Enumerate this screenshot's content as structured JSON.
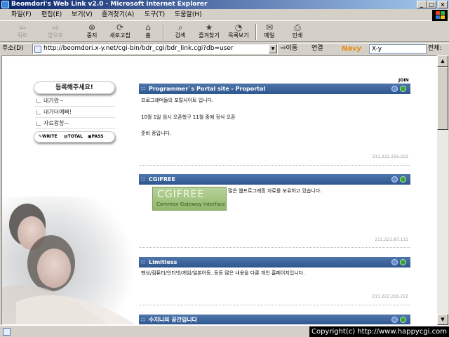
{
  "window": {
    "title": "Beomdori's Web Link v2.0 - Microsoft Internet Explorer",
    "controls": {
      "minimize": "_",
      "maximize": "□",
      "close": "×"
    }
  },
  "menu": [
    "파일(F)",
    "편집(E)",
    "보기(V)",
    "즐겨찾기(A)",
    "도구(T)",
    "도움말(H)"
  ],
  "toolbar": {
    "back": "뒤로",
    "forward": "앞으로",
    "stop": "중지",
    "refresh": "새로고침",
    "home": "홈",
    "search": "검색",
    "favorites": "즐겨찾기",
    "history": "목록보기",
    "mail": "메일",
    "print": "인쇄"
  },
  "address": {
    "label": "주소(D)",
    "url": "http://beomdori.x-y.net/cgi-bin/bdr_cgi/bdr_link.cgi?db=user",
    "go": "이동",
    "links": "연결",
    "navy_logo": "Navy",
    "navy_input": "X-y",
    "navy_button": "전체:"
  },
  "left": {
    "register_button": "등록해주세요!",
    "menu": [
      "내가왔~",
      "내가더예뻐!",
      "자료왕창~"
    ],
    "tools": [
      "WRITE",
      "TOTAL",
      "PASS"
    ]
  },
  "join_label": "JOIN",
  "posts": [
    {
      "title": "Programmer`s Portal site - Proportal",
      "lines": [
        "프로그래머들의 포탈사이트 입니다.",
        "10월 1일 임시 오픈했구 11월 중에 정식 오픈",
        "준비 중입니다."
      ],
      "ip": "211.222.216.222"
    },
    {
      "title": "CGIFREE",
      "banner": {
        "big": "CGIFREE",
        "small": "Common Gateway Interface"
      },
      "lines": [
        "많은 웹프로그래밍 자료를 보유하고 있습니다."
      ],
      "ip": "211.221.87.111"
    },
    {
      "title": "Limitless",
      "lines": [
        "팬싱/컴퓨터/인터넷/게임/일본어등..등등 많은 내용을 다룬 개인 홈페이지입니다."
      ],
      "ip": "211.222.216.222"
    },
    {
      "title": "수지니의 공간입니다",
      "lines": [],
      "ip": ""
    }
  ],
  "status": {
    "copyright": "Copyright(c) http://www.happycgi.com"
  }
}
